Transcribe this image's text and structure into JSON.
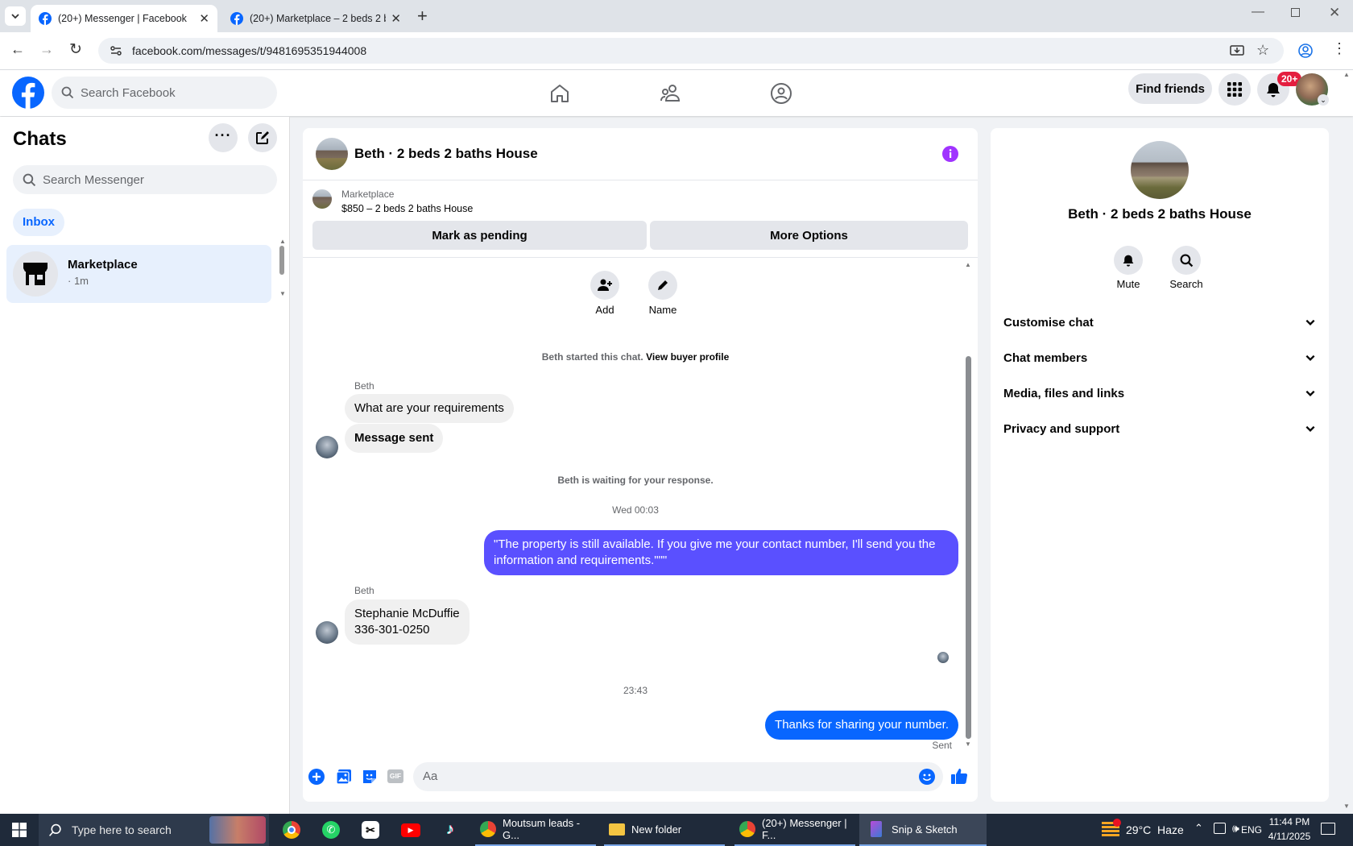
{
  "browser": {
    "tabs": [
      {
        "title": "(20+) Messenger | Facebook",
        "active": true
      },
      {
        "title": "(20+) Marketplace – 2 beds 2 b",
        "active": false
      }
    ],
    "url": "facebook.com/messages/t/9481695351944008"
  },
  "fb_header": {
    "search_placeholder": "Search Facebook",
    "find_friends_label": "Find friends",
    "notifications_badge": "20+"
  },
  "sidebar": {
    "title": "Chats",
    "search_placeholder": "Search Messenger",
    "filter_label": "Inbox",
    "conversations": [
      {
        "name": "Marketplace",
        "subtitle": "· 1m"
      }
    ]
  },
  "chat": {
    "title": "Beth · 2 beds 2 baths House",
    "listing": {
      "label": "Marketplace",
      "title": "$850 – 2 beds 2 baths House"
    },
    "mark_pending_label": "Mark as pending",
    "more_options_label": "More Options",
    "actions": [
      {
        "label": "Add",
        "icon": "add-person-icon"
      },
      {
        "label": "Name",
        "icon": "pencil-icon"
      }
    ],
    "started_text": "Beth started this chat.",
    "view_profile_label": "View buyer profile",
    "messages": {
      "sender_name_1": "Beth",
      "m1": "What are your requirements",
      "m2": "Message sent",
      "waiting_text": "Beth is waiting for your response.",
      "timestamp_1": "Wed 00:03",
      "m3": "\"The property is still available. If you give me your contact number, I'll send you the information and requirements.\"\"\"",
      "sender_name_2": "Beth",
      "m4_line1": "Stephanie McDuffie",
      "m4_line2": "336-301-0250",
      "timestamp_2": "23:43",
      "m5": "Thanks for sharing your number.",
      "status": "Sent"
    },
    "composer_placeholder": "Aa"
  },
  "details_panel": {
    "name": "Beth · 2 beds 2 baths House",
    "mute_label": "Mute",
    "search_label": "Search",
    "sections": [
      "Customise chat",
      "Chat members",
      "Media, files and links",
      "Privacy and support"
    ]
  },
  "taskbar": {
    "search_placeholder": "Type here to search",
    "apps": [
      {
        "label": "Moutsum leads - G..."
      },
      {
        "label": "New folder"
      },
      {
        "label": "(20+) Messenger | F..."
      },
      {
        "label": "Snip & Sketch"
      }
    ],
    "weather": "29°C  Haze",
    "language": "ENG",
    "time": "11:44 PM",
    "date": "4/11/2025"
  },
  "colors": {
    "facebook_blue": "#0866ff",
    "outgoing_bubble_purple": "#5a50ff",
    "outgoing_bubble_blue": "#0866ff",
    "info_icon_purple": "#a033ff",
    "badge_red": "#e41e3f"
  }
}
